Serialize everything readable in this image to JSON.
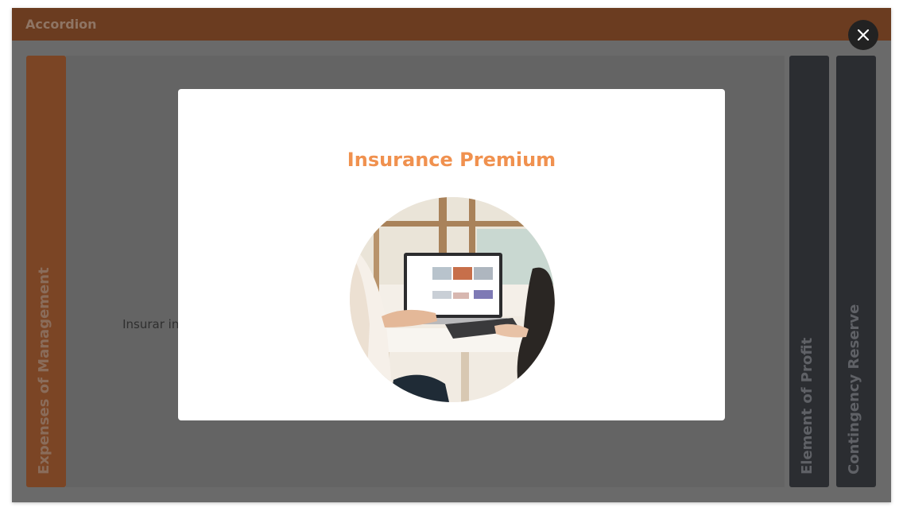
{
  "window": {
    "title": "Accordion"
  },
  "accordion": {
    "panels": [
      {
        "label": "Expenses of Management",
        "state": "active"
      },
      {
        "label": "Element of Profit",
        "state": "collapsed"
      },
      {
        "label": "Contingency Reserve",
        "state": "collapsed"
      }
    ],
    "content_text": "Insurar insurance"
  },
  "modal": {
    "title": "Insurance Premium",
    "image": "photo of two people using a laptop at a table",
    "close_icon": "close-icon"
  },
  "colors": {
    "accent": "#f0914f",
    "header": "#6b3c20",
    "active_panel": "#7b4525",
    "dark_panel": "#2b2d31"
  }
}
